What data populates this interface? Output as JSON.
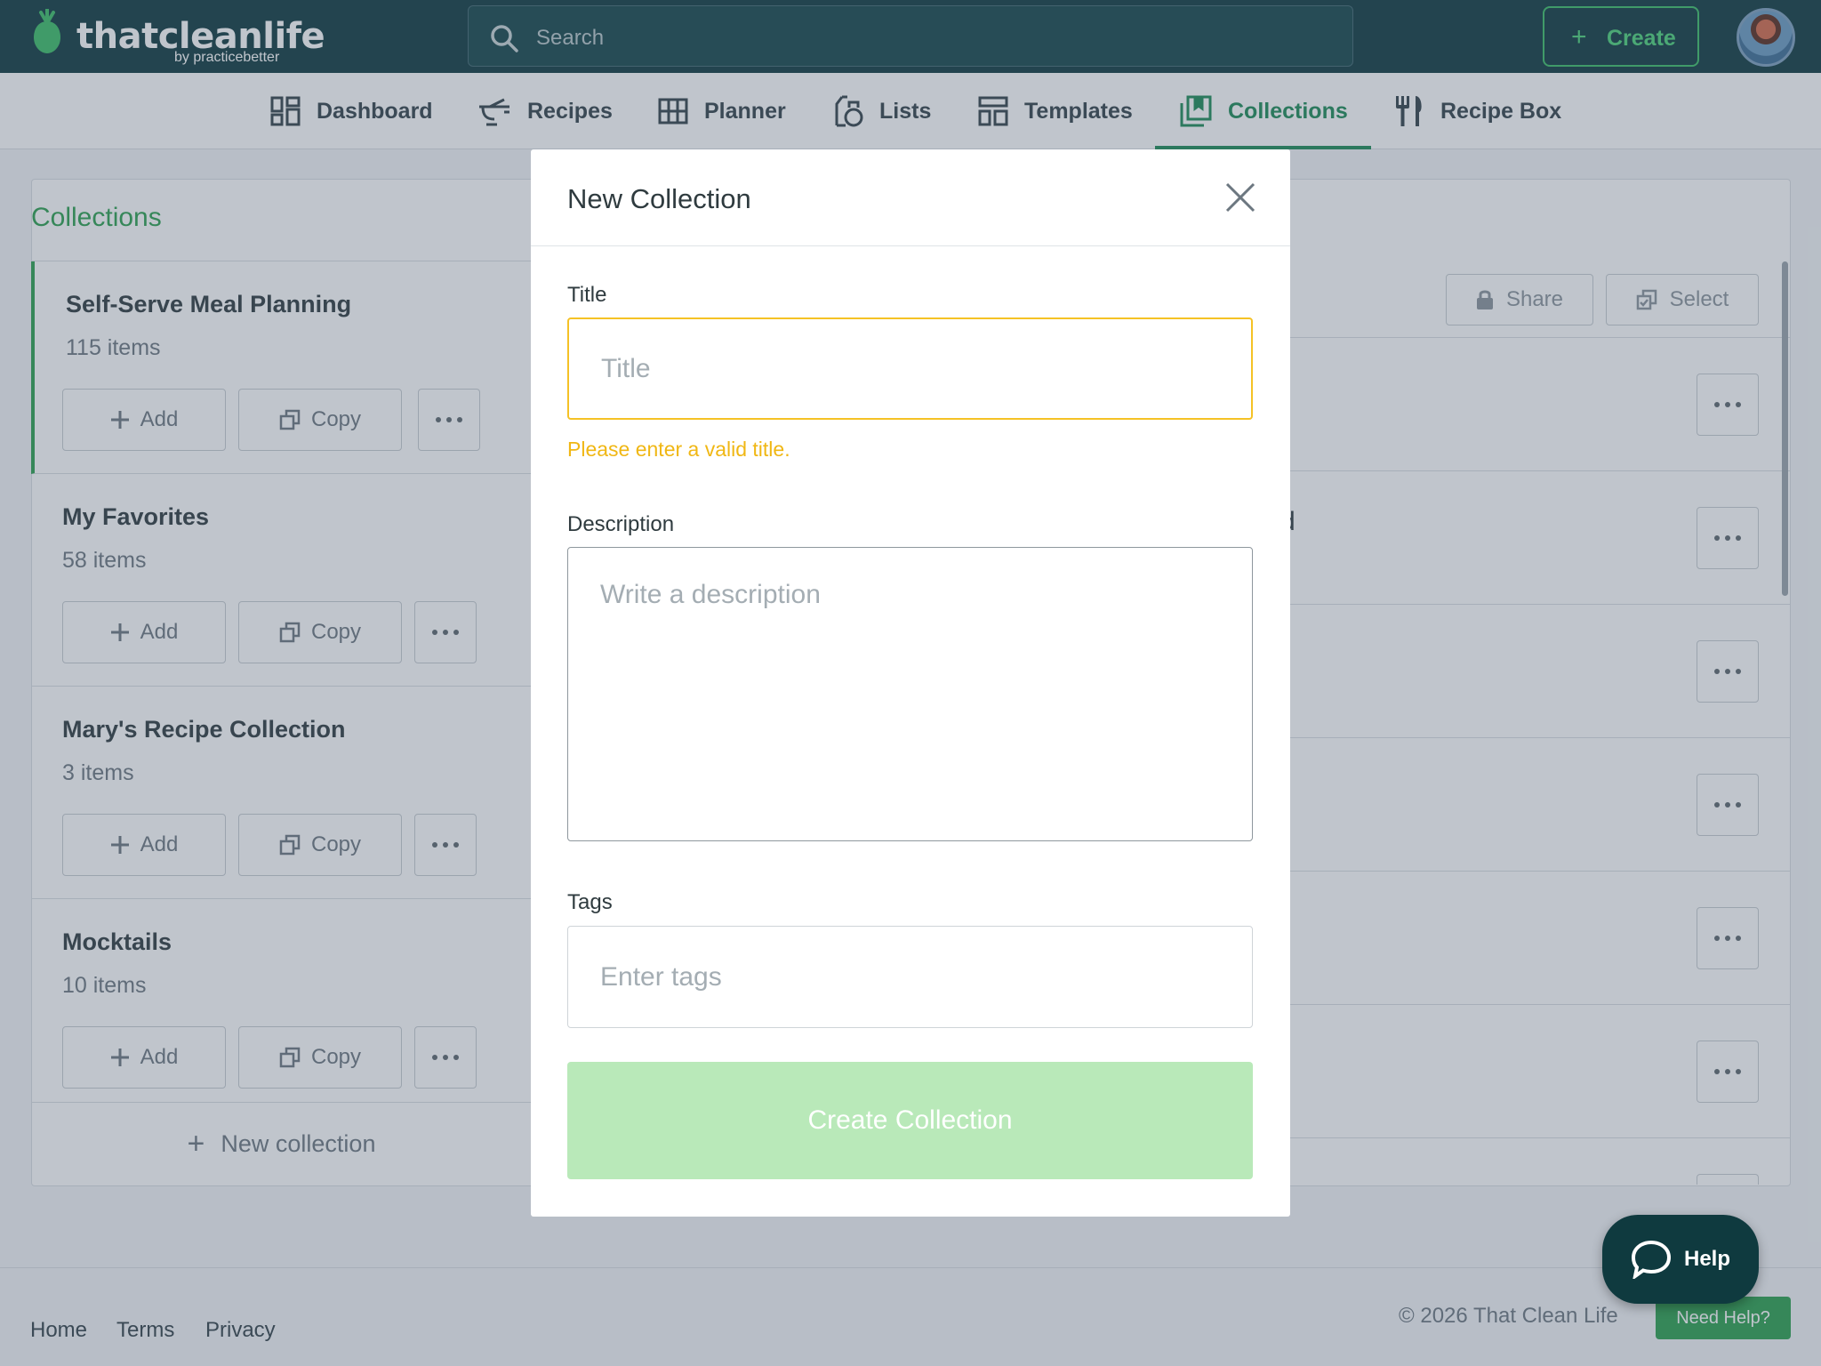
{
  "app": {
    "brand": "thatcleanlife",
    "byline": "by practicebetter",
    "search_placeholder": "Search",
    "create_label": "Create"
  },
  "nav": {
    "items": [
      {
        "label": "Dashboard",
        "icon": "dashboard-icon"
      },
      {
        "label": "Recipes",
        "icon": "recipes-icon"
      },
      {
        "label": "Planner",
        "icon": "planner-icon"
      },
      {
        "label": "Lists",
        "icon": "lists-icon"
      },
      {
        "label": "Templates",
        "icon": "templates-icon"
      },
      {
        "label": "Collections",
        "icon": "collections-icon",
        "active": true
      },
      {
        "label": "Recipe Box",
        "icon": "fork-knife-icon"
      }
    ]
  },
  "sidebar": {
    "title": "Collections",
    "collections": [
      {
        "name": "Self-Serve Meal Planning",
        "count": "115 items",
        "selected": true
      },
      {
        "name": "My Favorites",
        "count": "58 items"
      },
      {
        "name": "Mary's Recipe Collection",
        "count": "3 items"
      },
      {
        "name": "Mocktails",
        "count": "10 items"
      }
    ],
    "add_label": "Add",
    "copy_label": "Copy",
    "new_collection_label": "New collection"
  },
  "content": {
    "share_label": "Share",
    "select_label": "Select",
    "partial_text": "d"
  },
  "modal": {
    "title": "New Collection",
    "title_label": "Title",
    "title_placeholder": "Title",
    "title_error": "Please enter a valid title.",
    "description_label": "Description",
    "description_placeholder": "Write a description",
    "tags_label": "Tags",
    "tags_placeholder": "Enter tags",
    "submit_label": "Create Collection"
  },
  "footer": {
    "links": [
      "Home",
      "Terms",
      "Privacy"
    ],
    "copyright": "© 2026 That Clean Life",
    "need_help": "Need Help?",
    "help_label": "Help"
  },
  "colors": {
    "header_bg": "#0f3a3f",
    "accent_green": "#2ca04f",
    "error_yellow": "#f5c226",
    "submit_disabled": "#b9e9b9"
  }
}
